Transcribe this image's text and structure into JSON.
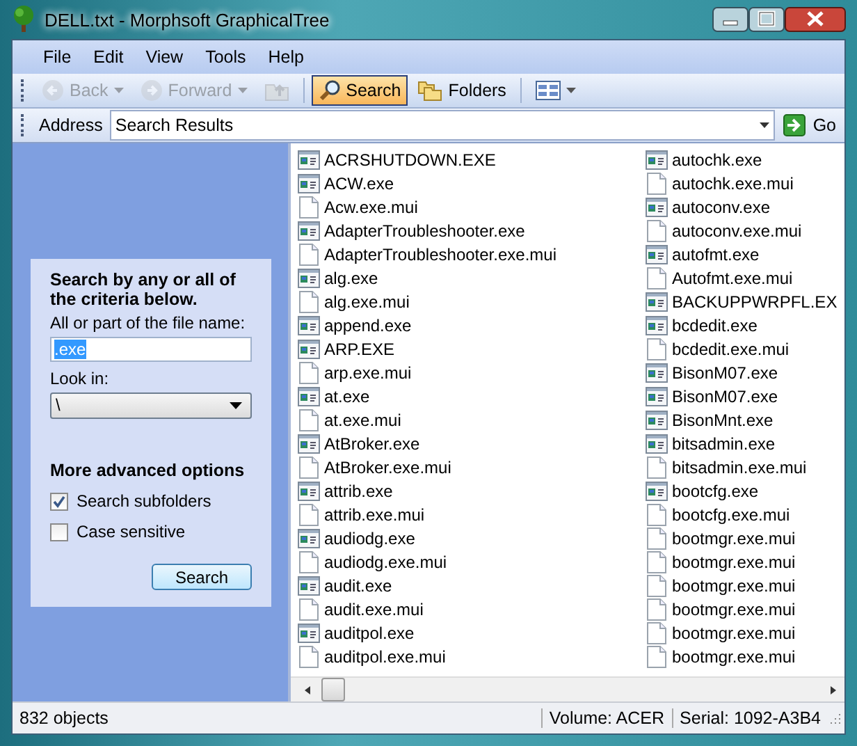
{
  "window": {
    "title": "DELL.txt - Morphsoft GraphicalTree"
  },
  "menu": [
    "File",
    "Edit",
    "View",
    "Tools",
    "Help"
  ],
  "toolbar": [
    {
      "kind": "back",
      "label": "Back",
      "disabled": true,
      "selected": false
    },
    {
      "kind": "forward",
      "label": "Forward",
      "disabled": true,
      "selected": false
    },
    {
      "kind": "up",
      "disabled": true,
      "selected": false
    },
    {
      "kind": "search",
      "label": "Search",
      "disabled": false,
      "selected": true
    },
    {
      "kind": "folders",
      "label": "Folders",
      "disabled": false,
      "selected": false
    },
    {
      "kind": "views",
      "disabled": false,
      "selected": false
    }
  ],
  "address": {
    "label": "Address",
    "value": "Search Results",
    "go": "Go"
  },
  "search_pane": {
    "heading": "Search by any or all of the criteria below.",
    "name_label": "All or part of the file name:",
    "name_value": ".exe",
    "look_in_label": "Look in:",
    "look_in_value": "\\",
    "advanced_heading": "More advanced options",
    "options": [
      {
        "label": "Search subfolders",
        "checked": true
      },
      {
        "label": "Case sensitive",
        "checked": false
      }
    ],
    "button": "Search"
  },
  "files": [
    {
      "name": "ACRSHUTDOWN.EXE",
      "kind": "exe"
    },
    {
      "name": "ACW.exe",
      "kind": "exe"
    },
    {
      "name": "Acw.exe.mui",
      "kind": "file"
    },
    {
      "name": "AdapterTroubleshooter.exe",
      "kind": "exe"
    },
    {
      "name": "AdapterTroubleshooter.exe.mui",
      "kind": "file"
    },
    {
      "name": "alg.exe",
      "kind": "exe"
    },
    {
      "name": "alg.exe.mui",
      "kind": "file"
    },
    {
      "name": "append.exe",
      "kind": "exe"
    },
    {
      "name": "ARP.EXE",
      "kind": "exe"
    },
    {
      "name": "arp.exe.mui",
      "kind": "file"
    },
    {
      "name": "at.exe",
      "kind": "exe"
    },
    {
      "name": "at.exe.mui",
      "kind": "file"
    },
    {
      "name": "AtBroker.exe",
      "kind": "exe"
    },
    {
      "name": "AtBroker.exe.mui",
      "kind": "file"
    },
    {
      "name": "attrib.exe",
      "kind": "exe"
    },
    {
      "name": "attrib.exe.mui",
      "kind": "file"
    },
    {
      "name": "audiodg.exe",
      "kind": "exe"
    },
    {
      "name": "audiodg.exe.mui",
      "kind": "file"
    },
    {
      "name": "audit.exe",
      "kind": "exe"
    },
    {
      "name": "audit.exe.mui",
      "kind": "file"
    },
    {
      "name": "auditpol.exe",
      "kind": "exe"
    },
    {
      "name": "auditpol.exe.mui",
      "kind": "file"
    },
    {
      "name": "autochk.exe",
      "kind": "exe"
    },
    {
      "name": "autochk.exe.mui",
      "kind": "file"
    },
    {
      "name": "autoconv.exe",
      "kind": "exe"
    },
    {
      "name": "autoconv.exe.mui",
      "kind": "file"
    },
    {
      "name": "autofmt.exe",
      "kind": "exe"
    },
    {
      "name": "Autofmt.exe.mui",
      "kind": "file"
    },
    {
      "name": "BACKUPPWRPFL.EX",
      "kind": "exe"
    },
    {
      "name": "bcdedit.exe",
      "kind": "exe"
    },
    {
      "name": "bcdedit.exe.mui",
      "kind": "file"
    },
    {
      "name": "BisonM07.exe",
      "kind": "exe"
    },
    {
      "name": "BisonM07.exe",
      "kind": "exe"
    },
    {
      "name": "BisonMnt.exe",
      "kind": "exe"
    },
    {
      "name": "bitsadmin.exe",
      "kind": "exe"
    },
    {
      "name": "bitsadmin.exe.mui",
      "kind": "file"
    },
    {
      "name": "bootcfg.exe",
      "kind": "exe"
    },
    {
      "name": "bootcfg.exe.mui",
      "kind": "file"
    },
    {
      "name": "bootmgr.exe.mui",
      "kind": "file"
    },
    {
      "name": "bootmgr.exe.mui",
      "kind": "file"
    },
    {
      "name": "bootmgr.exe.mui",
      "kind": "file"
    },
    {
      "name": "bootmgr.exe.mui",
      "kind": "file"
    },
    {
      "name": "bootmgr.exe.mui",
      "kind": "file"
    },
    {
      "name": "bootmgr.exe.mui",
      "kind": "file"
    }
  ],
  "status_bar": {
    "count": "832 objects",
    "volume": "Volume: ACER",
    "serial": "Serial: 1092-A3B4"
  }
}
